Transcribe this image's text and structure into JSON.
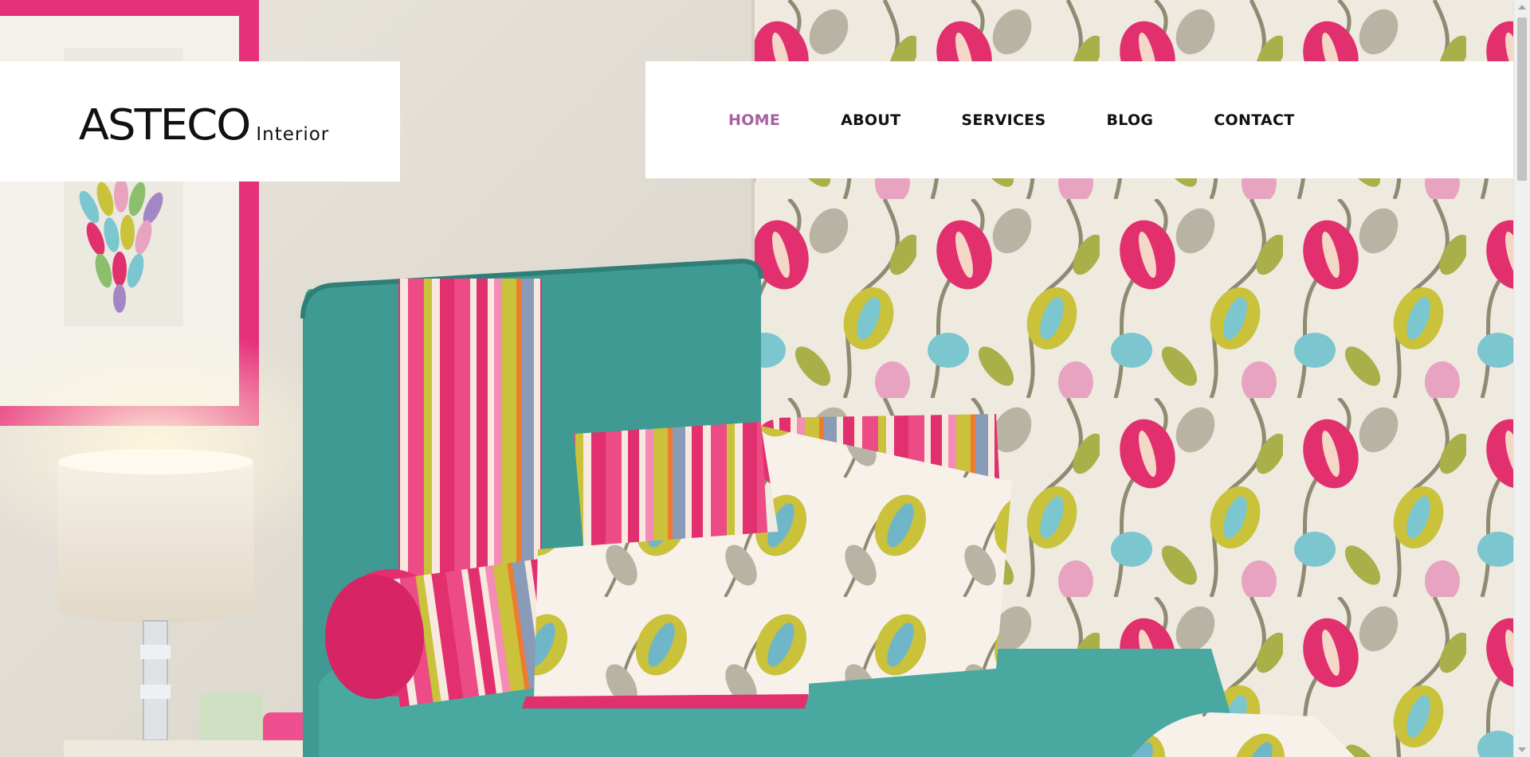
{
  "brand": {
    "name": "ASTECO",
    "tagline": "Interior"
  },
  "nav": {
    "items": [
      {
        "label": "HOME",
        "active": true
      },
      {
        "label": "ABOUT",
        "active": false
      },
      {
        "label": "SERVICES",
        "active": false
      },
      {
        "label": "BLOG",
        "active": false
      },
      {
        "label": "CONTACT",
        "active": false
      }
    ]
  },
  "colors": {
    "nav_active": "#a7609f",
    "nav_text": "#111111",
    "header_bg": "#ffffff",
    "wall": "#ece7df",
    "teal_sofa": "#3e9a92",
    "pink_accent": "#e2306f",
    "lime_accent": "#c9c23a",
    "blue_accent": "#7cc6d0"
  },
  "hero": {
    "icon": "interior-photo-image"
  },
  "scrollbar": {
    "thumb_icon": "scrollbar-thumb",
    "up_icon": "scroll-up-arrow-icon",
    "down_icon": "scroll-down-arrow-icon"
  }
}
